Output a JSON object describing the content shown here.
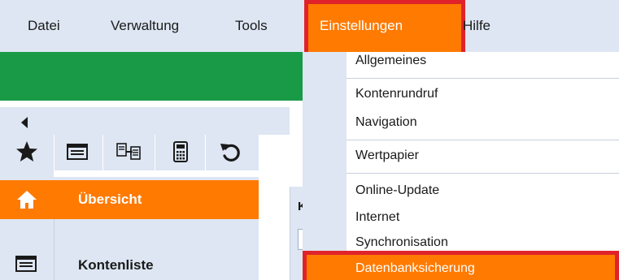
{
  "menubar": {
    "items": [
      "Datei",
      "Verwaltung",
      "Tools",
      "Einstellungen",
      "Hilfe"
    ]
  },
  "sidebar": {
    "toolbar_icons": [
      "star-icon",
      "account-list-icon",
      "transfer-icon",
      "calculator-icon",
      "refresh-icon"
    ],
    "nav": [
      {
        "label": "Übersicht",
        "icon": "home-icon",
        "active": true
      },
      {
        "label": "Kontenliste",
        "icon": "list-icon",
        "active": false
      }
    ]
  },
  "content": {
    "panel_letter": "K"
  },
  "dropdown": {
    "items": [
      "Allgemeines",
      "Kontenrundruf",
      "Navigation",
      "Wertpapier",
      "Online-Update",
      "Internet",
      "Synchronisation",
      "Datenbanksicherung"
    ],
    "highlighted_index": 7
  },
  "colors": {
    "accent_orange": "#ff7a00",
    "highlight_red": "#e0232a",
    "header_green": "#199a46",
    "pale_blue": "#dde6f2"
  }
}
